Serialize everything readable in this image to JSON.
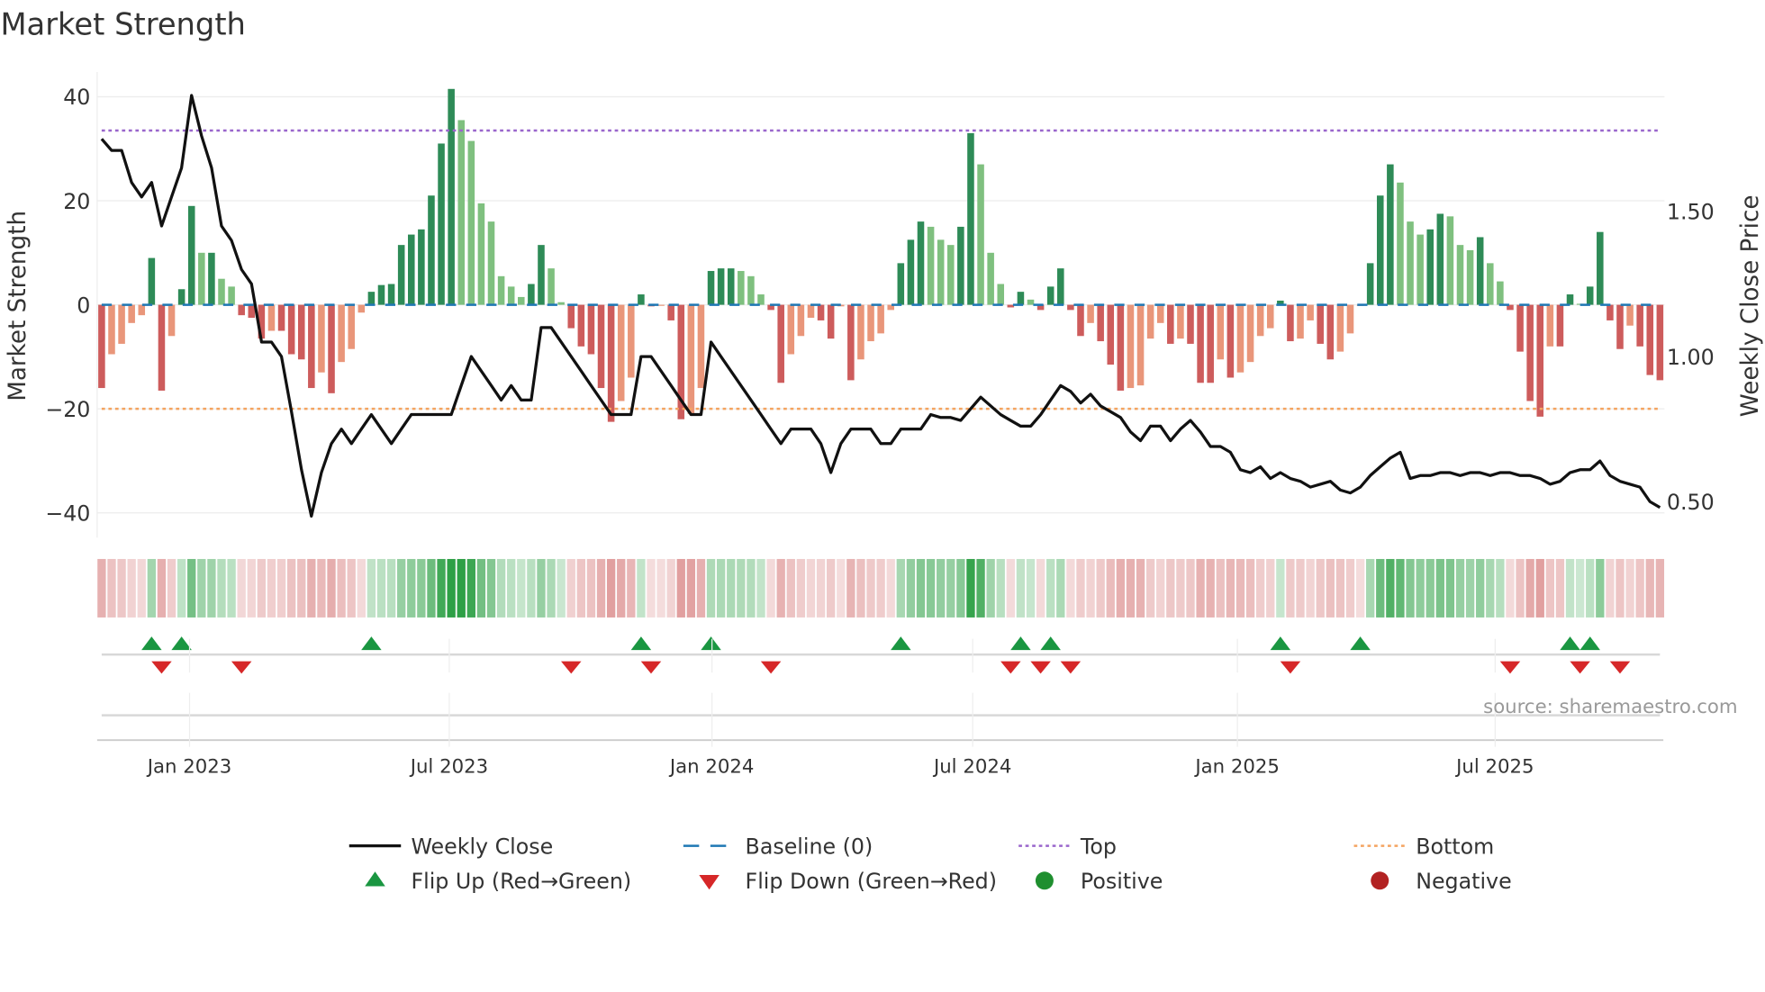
{
  "chart_data": {
    "type": "bar",
    "title": "Market Strength",
    "ylabel": "Market Strength",
    "y2label": "Weekly Close Price",
    "ylim": [
      -45,
      45
    ],
    "y2lim": [
      0.42,
      2.0
    ],
    "yticks": [
      40,
      20,
      0,
      -20,
      -40
    ],
    "ytick_labels": [
      "40",
      "20",
      "0",
      "−20",
      "−40"
    ],
    "y2ticks": [
      1.5,
      1.0,
      0.5
    ],
    "y2tick_labels": [
      "1.50",
      "1.00",
      "0.50"
    ],
    "xticks": [
      8.8,
      34.8,
      61.1,
      87.2,
      113.7,
      139.5
    ],
    "xtick_labels": [
      "Jan 2023",
      "Jul 2023",
      "Jan 2024",
      "Jul 2024",
      "Jan 2025",
      "Jul 2025"
    ],
    "grid": true,
    "top_level": 33.5,
    "bottom_level": -20,
    "baseline": 0,
    "strength": [
      -16,
      -9.5,
      -7.5,
      -3.5,
      -2,
      9,
      -16.5,
      -6,
      3,
      19,
      10,
      10,
      5,
      3.5,
      -2,
      -2.5,
      -6.5,
      -5,
      -5,
      -9.5,
      -10.5,
      -16,
      -13,
      -17,
      -11,
      -8.5,
      -1.5,
      2.5,
      3.8,
      4,
      11.5,
      13.5,
      14.5,
      21,
      31,
      41.5,
      35.5,
      31.5,
      19.5,
      16,
      5.5,
      3.5,
      1.5,
      4,
      11.5,
      7,
      0.5,
      -4.5,
      -8,
      -9.5,
      -16,
      -22.5,
      -18.5,
      -14,
      2,
      -0.3,
      -0.2,
      -3,
      -22,
      -21,
      -16,
      6.5,
      7,
      7,
      6.5,
      5.5,
      2,
      -1,
      -15,
      -9.5,
      -6,
      -2.5,
      -3,
      -6.5,
      -0.3,
      -14.5,
      -10.5,
      -7,
      -5.5,
      -1,
      8,
      12.5,
      16,
      15,
      12.5,
      11.5,
      15,
      33,
      27,
      10,
      4,
      -0.5,
      2.5,
      1,
      -1,
      3.5,
      7,
      -1,
      -6,
      -3.5,
      -7,
      -11.5,
      -16.5,
      -16,
      -15.5,
      -6.5,
      -3.5,
      -7.5,
      -6.5,
      -7.5,
      -15,
      -15,
      -10.5,
      -14,
      -13,
      -11,
      -6,
      -4.5,
      0.8,
      -7,
      -6.5,
      -3,
      -7.5,
      -10.5,
      -9,
      -5.5,
      -0.2,
      8,
      21,
      27,
      23.5,
      16,
      13.5,
      14.5,
      17.5,
      17,
      11.5,
      10.5,
      13,
      8,
      4.5,
      -1,
      -9,
      -18.5,
      -21.5,
      -8,
      -8,
      2,
      0.2,
      3.5,
      14,
      -3,
      -8.5,
      -4,
      -8,
      -13.5,
      -14.5
    ],
    "weekly_close": [
      1.75,
      1.71,
      1.71,
      1.6,
      1.55,
      1.6,
      1.45,
      1.55,
      1.65,
      1.9,
      1.76,
      1.65,
      1.45,
      1.4,
      1.3,
      1.25,
      1.05,
      1.05,
      1.0,
      0.81,
      0.61,
      0.45,
      0.6,
      0.7,
      0.75,
      0.7,
      0.75,
      0.8,
      0.75,
      0.7,
      0.75,
      0.8,
      0.8,
      0.8,
      0.8,
      0.8,
      0.9,
      1.0,
      0.95,
      0.9,
      0.85,
      0.9,
      0.85,
      0.85,
      1.1,
      1.1,
      1.05,
      1.0,
      0.95,
      0.9,
      0.85,
      0.8,
      0.8,
      0.8,
      1.0,
      1.0,
      0.95,
      0.9,
      0.85,
      0.8,
      0.8,
      1.05,
      1.0,
      0.95,
      0.9,
      0.85,
      0.8,
      0.75,
      0.7,
      0.75,
      0.75,
      0.75,
      0.7,
      0.6,
      0.7,
      0.75,
      0.75,
      0.75,
      0.7,
      0.7,
      0.75,
      0.75,
      0.75,
      0.8,
      0.79,
      0.79,
      0.78,
      0.82,
      0.86,
      0.83,
      0.8,
      0.78,
      0.76,
      0.76,
      0.8,
      0.85,
      0.9,
      0.88,
      0.84,
      0.87,
      0.83,
      0.81,
      0.79,
      0.74,
      0.71,
      0.76,
      0.76,
      0.71,
      0.75,
      0.78,
      0.74,
      0.69,
      0.69,
      0.67,
      0.61,
      0.6,
      0.62,
      0.58,
      0.6,
      0.58,
      0.57,
      0.55,
      0.56,
      0.57,
      0.54,
      0.53,
      0.55,
      0.59,
      0.62,
      0.65,
      0.67,
      0.58,
      0.59,
      0.59,
      0.6,
      0.6,
      0.59,
      0.6,
      0.6,
      0.59,
      0.6,
      0.6,
      0.59,
      0.59,
      0.58,
      0.56,
      0.57,
      0.6,
      0.61,
      0.61,
      0.64,
      0.59,
      0.57,
      0.56,
      0.55,
      0.5,
      0.48
    ],
    "flip_up_weeks": [
      5,
      8,
      27,
      54,
      61,
      80,
      92,
      95,
      118,
      126,
      147,
      149
    ],
    "flip_down_weeks": [
      6,
      14,
      47,
      55,
      67,
      91,
      94,
      97,
      119,
      141,
      148,
      152
    ],
    "annotation": "source: sharemaestro.com",
    "legend": [
      {
        "label": "Weekly Close",
        "kind": "line"
      },
      {
        "label": "Baseline (0)",
        "kind": "dash"
      },
      {
        "label": "Top",
        "kind": "dot-top"
      },
      {
        "label": "Bottom",
        "kind": "dot-bottom"
      },
      {
        "label": "Flip Up (Red→Green)",
        "kind": "tri-up"
      },
      {
        "label": "Flip Down (Green→Red)",
        "kind": "tri-down"
      },
      {
        "label": "Positive",
        "kind": "dot-pos"
      },
      {
        "label": "Negative",
        "kind": "dot-neg"
      }
    ],
    "legend_position": "bottom"
  },
  "colors": {
    "green_strong": "#2e8b57",
    "green_light": "#7fc07f",
    "red_strong": "#cd5c5c",
    "red_light": "#e9967a",
    "baseline": "#1f77b4",
    "top": "#9966cc",
    "bottom": "#f4a460",
    "line": "#111111",
    "flip_up": "#1a9641",
    "flip_down": "#d62728",
    "positive": "#1f8f2f",
    "negative": "#b22222"
  }
}
